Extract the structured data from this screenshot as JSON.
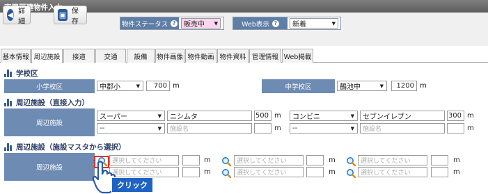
{
  "window": {
    "title": "売買戸建物件入力"
  },
  "toolbar": {
    "detail_label": "詳細",
    "save_label": "保存",
    "status_label": "物件ステータス",
    "status_value": "販売中",
    "web_label": "Web表示",
    "web_value": "新着"
  },
  "tabs": [
    "基本情報",
    "周辺施設",
    "接道",
    "交通",
    "設備",
    "物件画像",
    "物件動画",
    "物件資料",
    "管理情報",
    "Web掲載"
  ],
  "school": {
    "title": "学校区",
    "elementary_label": "小学校区",
    "elementary_value": "中郡小",
    "elementary_distance": "700",
    "junior_label": "中学校区",
    "junior_value": "鶴池中",
    "junior_distance": "1200",
    "unit": "m"
  },
  "facilities_direct": {
    "title": "周辺施設（直接入力）",
    "row_label": "周辺施設",
    "unit": "m",
    "rows": [
      {
        "type1": "スーパー",
        "name1": "ニシムタ",
        "dist1": "500",
        "type2": "コンビニ",
        "name2": "セブンイレブン",
        "dist2": "300"
      },
      {
        "type1": "--",
        "name1": "",
        "dist1": "",
        "type2": "--",
        "name2": "",
        "dist2": ""
      }
    ],
    "name_placeholder": "施設名"
  },
  "facilities_master": {
    "title": "周辺施設（施設マスタから選択）",
    "row_label": "周辺施設",
    "select_placeholder": "選択してください",
    "unit": "m"
  },
  "callout": {
    "label": "クリック"
  },
  "colors": {
    "band": "#6d8bb3",
    "title": "#2c3e66",
    "highlight": "#e0322d",
    "callout": "#1e63c4"
  }
}
